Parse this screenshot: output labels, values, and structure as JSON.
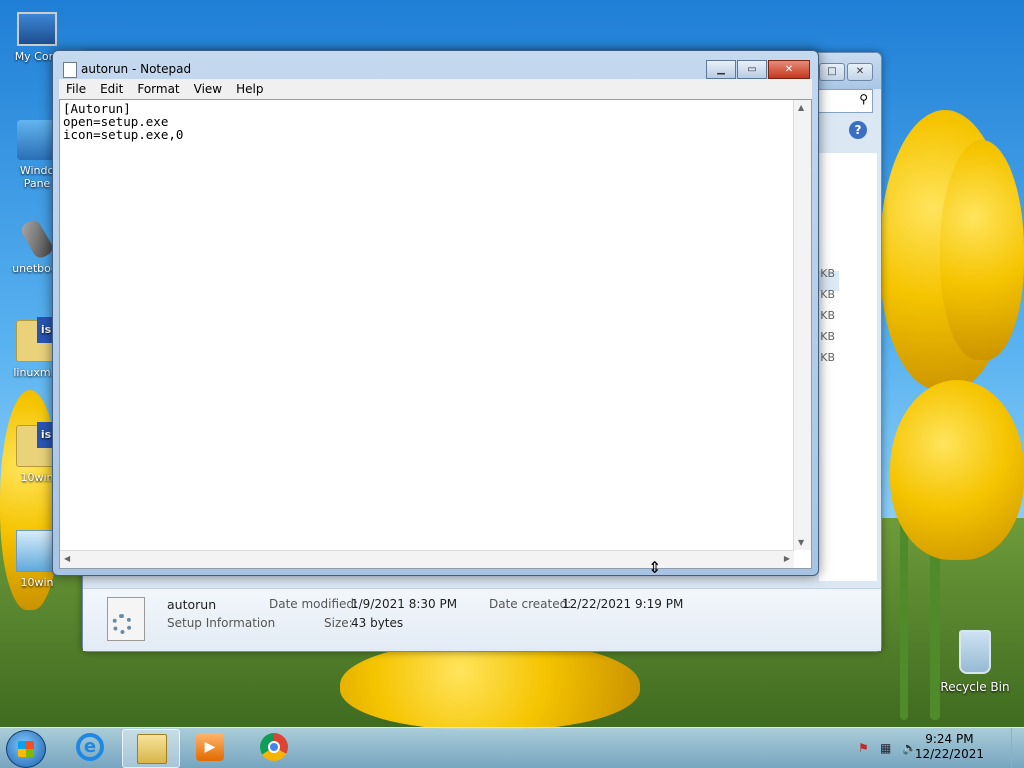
{
  "desktop": {
    "icons": [
      {
        "label": "My Com"
      },
      {
        "label": "Windo\nPane"
      },
      {
        "label": "unetboot"
      },
      {
        "label": "linuxmin"
      },
      {
        "label": "10win"
      },
      {
        "label": "10win"
      }
    ],
    "recycle_bin": "Recycle Bin"
  },
  "explorer": {
    "size_unit": "KB",
    "details": {
      "name": "autorun",
      "type": "Setup Information",
      "date_modified_label": "Date modified:",
      "date_modified": "1/9/2021 8:30 PM",
      "size_label": "Size:",
      "size": "43 bytes",
      "date_created_label": "Date created:",
      "date_created": "12/22/2021 9:19 PM"
    }
  },
  "notepad": {
    "title": "autorun - Notepad",
    "menu": [
      "File",
      "Edit",
      "Format",
      "View",
      "Help"
    ],
    "content": "[Autorun]\nopen=setup.exe\nicon=setup.exe,0"
  },
  "taskbar": {
    "time": "9:24 PM",
    "date": "12/22/2021"
  },
  "icons": {
    "minimize": "minimize-icon",
    "maximize": "maximize-icon",
    "close": "close-icon",
    "resize_cursor": "resize-cursor-icon"
  }
}
